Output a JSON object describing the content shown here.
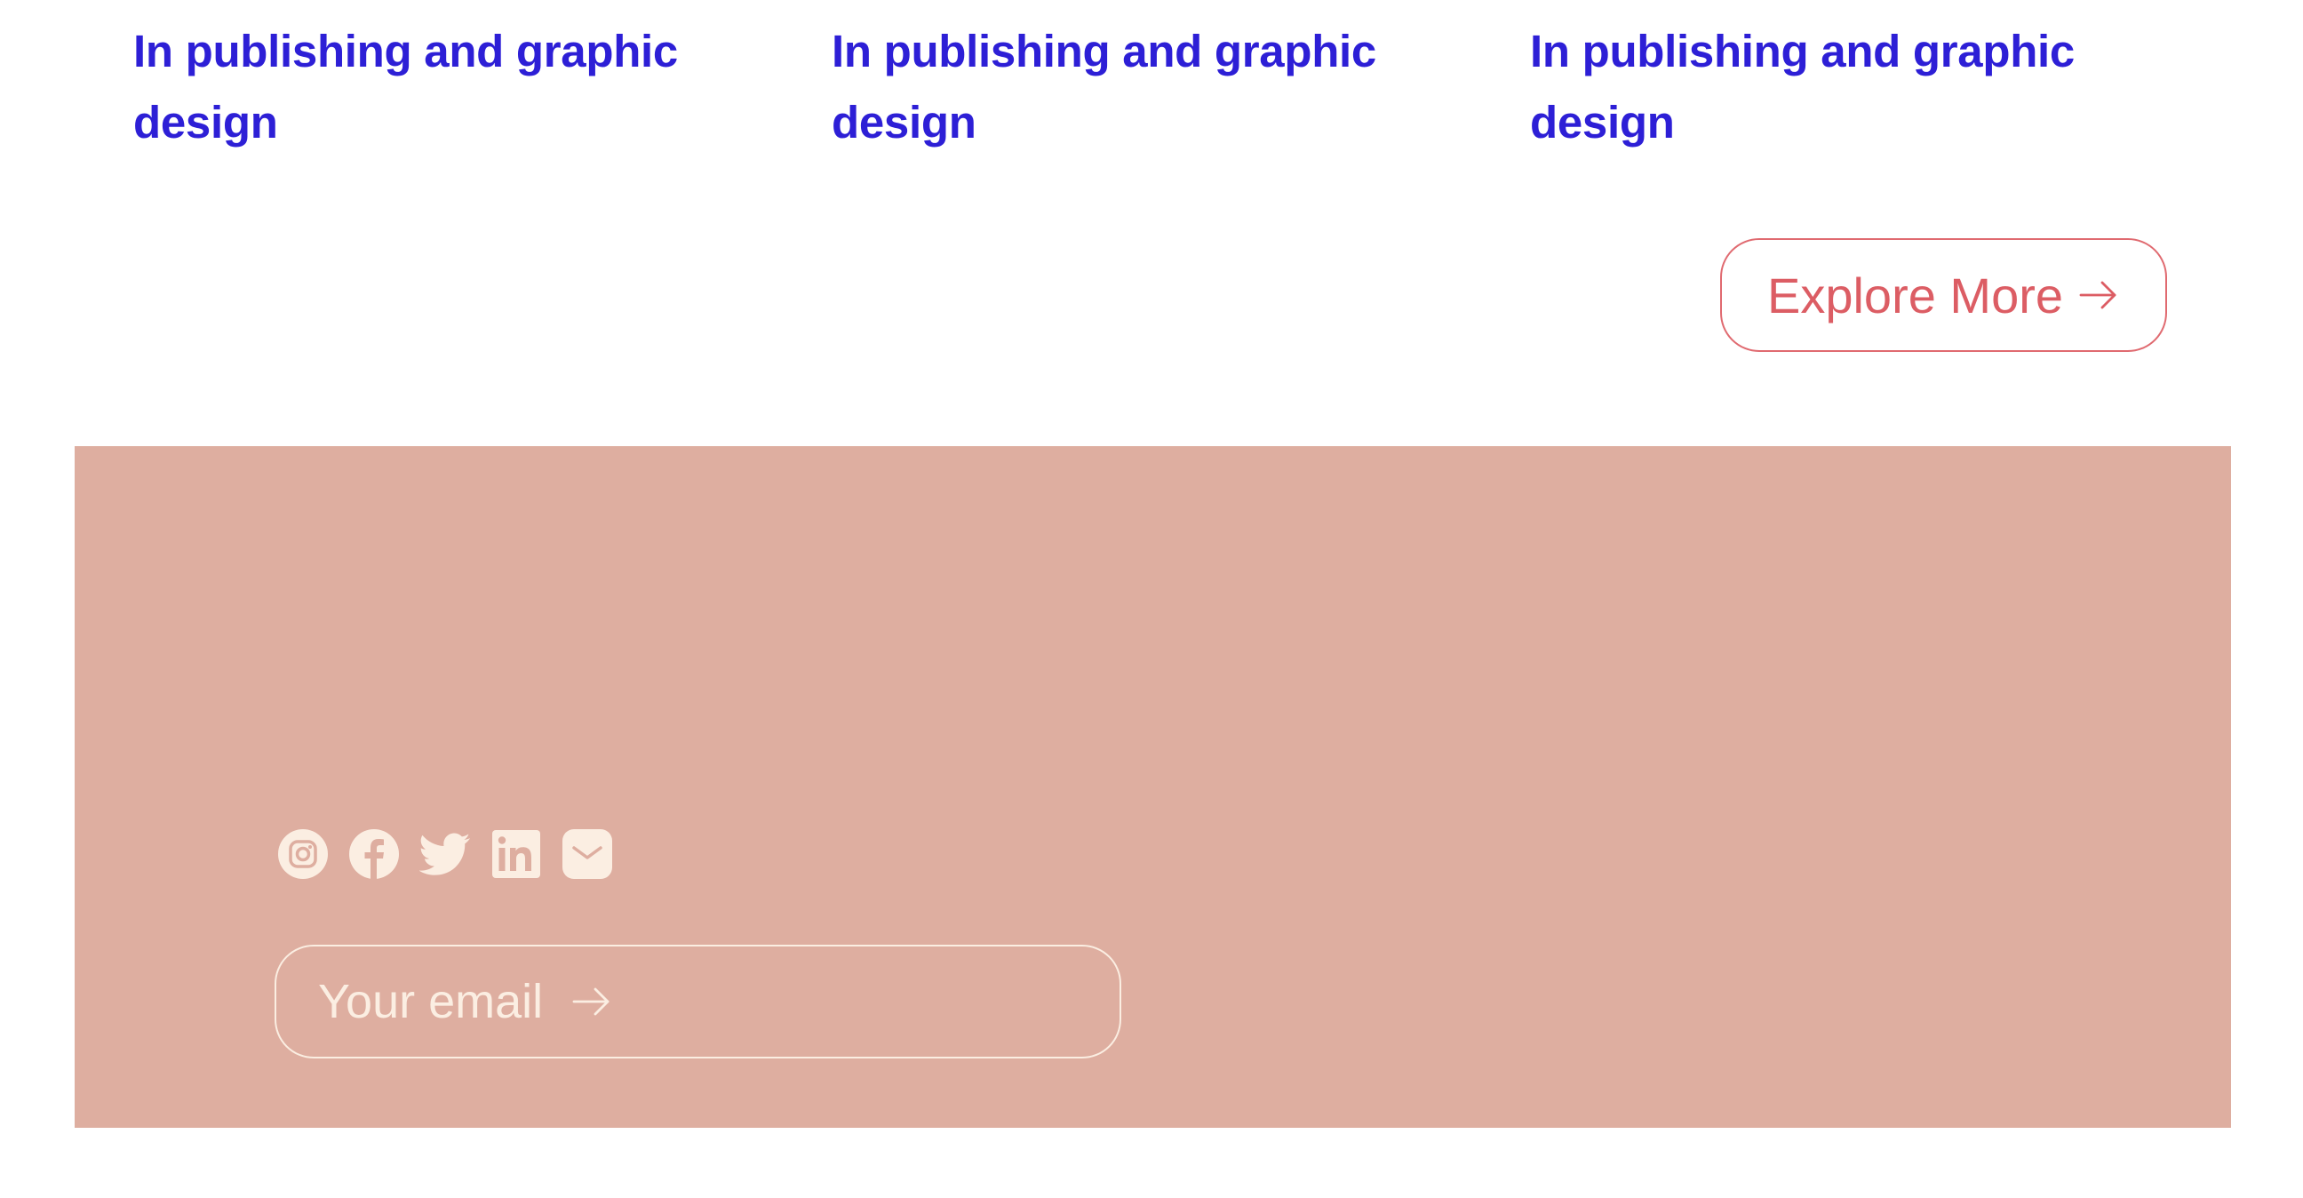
{
  "posts": [
    {
      "title": "In publishing and graphic design"
    },
    {
      "title": "In publishing and graphic design"
    },
    {
      "title": "In publishing and graphic design"
    }
  ],
  "explore": {
    "label": "Explore More",
    "icon": "arrow-right-icon"
  },
  "footer": {
    "social": [
      "instagram-icon",
      "facebook-icon",
      "twitter-icon",
      "linkedin-icon",
      "mail-icon"
    ],
    "email": {
      "placeholder": "Your email",
      "value": "",
      "icon": "arrow-right-icon"
    }
  },
  "colors": {
    "title": "#2d1fd6",
    "accent": "#dc5d64",
    "footer_bg": "#deaea0",
    "footer_fg": "#fbeee2"
  }
}
